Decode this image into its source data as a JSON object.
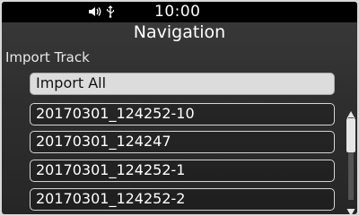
{
  "status": {
    "time": "10:00",
    "icons": [
      "volume-icon",
      "usb-icon"
    ]
  },
  "screen": {
    "title": "Navigation",
    "subtitle": "Import Track"
  },
  "list": {
    "items": [
      {
        "label": "Import All",
        "selected": true
      },
      {
        "label": "20170301_124252-10",
        "selected": false
      },
      {
        "label": "20170301_124247",
        "selected": false
      },
      {
        "label": "20170301_124252-1",
        "selected": false
      },
      {
        "label": "20170301_124252-2",
        "selected": false
      }
    ]
  },
  "colors": {
    "background": "#2f2f2f",
    "statusbar": "#000000",
    "selected_fill": "#dcdcdc",
    "item_border": "#d6d6d6"
  }
}
